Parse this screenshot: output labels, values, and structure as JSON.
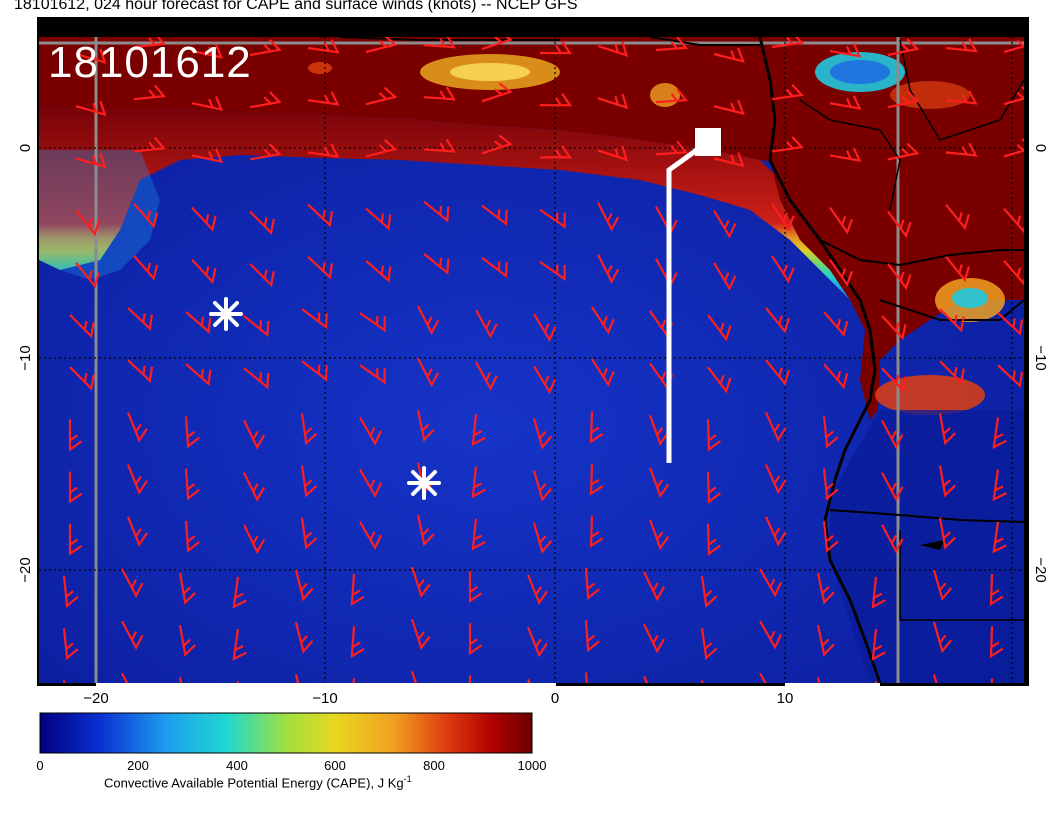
{
  "title": "18101612, 024 hour forecast for CAPE and surface winds (knots) -- NCEP GFS",
  "stamp": "18101612",
  "axes": {
    "x_ticks": [
      "−20",
      "−10",
      "0",
      "10"
    ],
    "y_ticks": [
      "0",
      "−10",
      "−20"
    ]
  },
  "colorbar": {
    "ticks": [
      "0",
      "200",
      "400",
      "600",
      "800",
      "1000"
    ],
    "label": "Convective Available Potential Energy (CAPE), J Kg",
    "label_sup": "-1",
    "colors": [
      "#000080",
      "#0a2fd0",
      "#1e9ff0",
      "#20d8d0",
      "#a0e040",
      "#e8d820",
      "#f0a020",
      "#e04010",
      "#b00000",
      "#6a0000"
    ]
  },
  "colors": {
    "ocean_low": "#0c1fa8",
    "cape_high": "#7a0000",
    "wind_barb": "#ff1e1e",
    "markers": "#ffffff",
    "grid": "#8c8c8c"
  },
  "markers": {
    "stars": 2,
    "track": "white track line with square endpoint"
  }
}
